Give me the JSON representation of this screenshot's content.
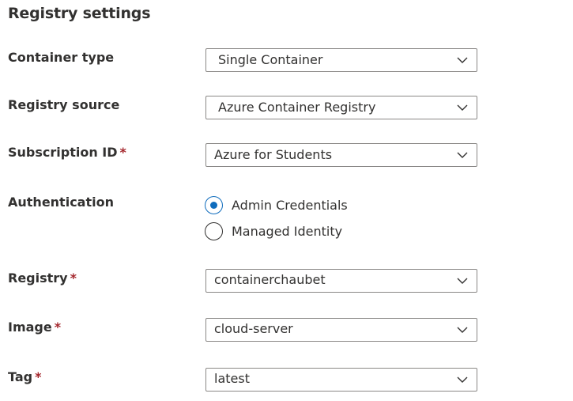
{
  "section": {
    "title": "Registry settings"
  },
  "fields": {
    "container_type": {
      "label": "Container type",
      "value": "Single Container"
    },
    "registry_source": {
      "label": "Registry source",
      "value": "Azure Container Registry"
    },
    "subscription_id": {
      "label": "Subscription ID",
      "required_mark": "*",
      "value": "Azure for Students"
    },
    "authentication": {
      "label": "Authentication",
      "options": [
        {
          "label": "Admin Credentials",
          "selected": true
        },
        {
          "label": "Managed Identity",
          "selected": false
        }
      ]
    },
    "registry": {
      "label": "Registry",
      "required_mark": "*",
      "value": "containerchaubet"
    },
    "image": {
      "label": "Image",
      "required_mark": "*",
      "value": "cloud-server"
    },
    "tag": {
      "label": "Tag",
      "required_mark": "*",
      "value": "latest"
    }
  },
  "icons": {
    "dropdown": "chevron-down-icon"
  },
  "colors": {
    "text": "#323130",
    "border": "#8a8886",
    "required": "#a4262c",
    "accent": "#0f6cbd"
  }
}
